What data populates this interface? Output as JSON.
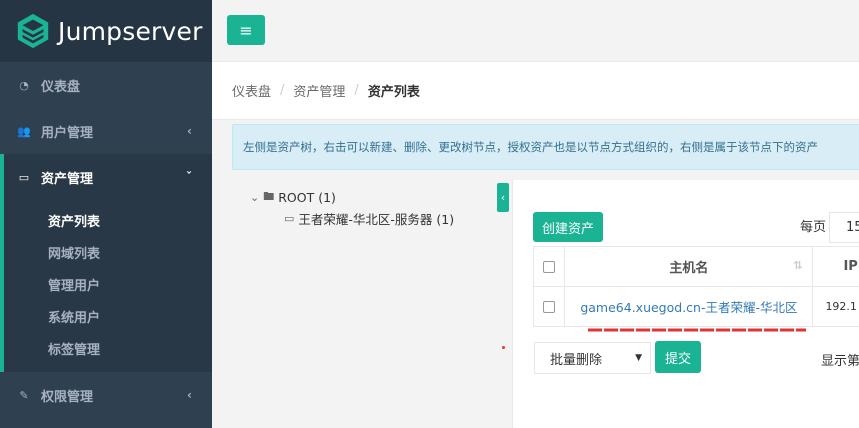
{
  "app": {
    "brand": "Jumpserver"
  },
  "sidebar": {
    "items": [
      {
        "label": "仪表盘",
        "icon": "dashboard-icon"
      },
      {
        "label": "用户管理",
        "icon": "users-icon"
      },
      {
        "label": "资产管理",
        "icon": "inbox-icon"
      },
      {
        "label": "权限管理",
        "icon": "edit-icon"
      }
    ],
    "assets_sub": [
      {
        "label": "资产列表"
      },
      {
        "label": "网域列表"
      },
      {
        "label": "管理用户"
      },
      {
        "label": "系统用户"
      },
      {
        "label": "标签管理"
      }
    ]
  },
  "breadcrumb": {
    "items": [
      "仪表盘",
      "资产管理",
      "资产列表"
    ],
    "separator": "/"
  },
  "alert": {
    "text": "左侧是资产树，右击可以新建、删除、更改树节点，授权资产也是以节点方式组织的，右侧是属于该节点下的资产"
  },
  "tree": {
    "root": "ROOT (1)",
    "child": "王者荣耀-华北区-服务器 (1)"
  },
  "toolbar": {
    "create_label": "创建资产",
    "per_page_label": "每页",
    "per_page_value": "15"
  },
  "table": {
    "headers": [
      "主机名",
      "IP"
    ],
    "rows": [
      {
        "hostname": "game64.xuegod.cn-王者荣耀-华北区",
        "ip": "192.1"
      }
    ]
  },
  "bulk": {
    "select_label": "批量删除",
    "submit_label": "提交",
    "show_label": "显示第"
  },
  "colors": {
    "accent": "#1ab394",
    "sidebar": "#2f4050",
    "link": "#337ab7",
    "annotation": "#e33333"
  }
}
